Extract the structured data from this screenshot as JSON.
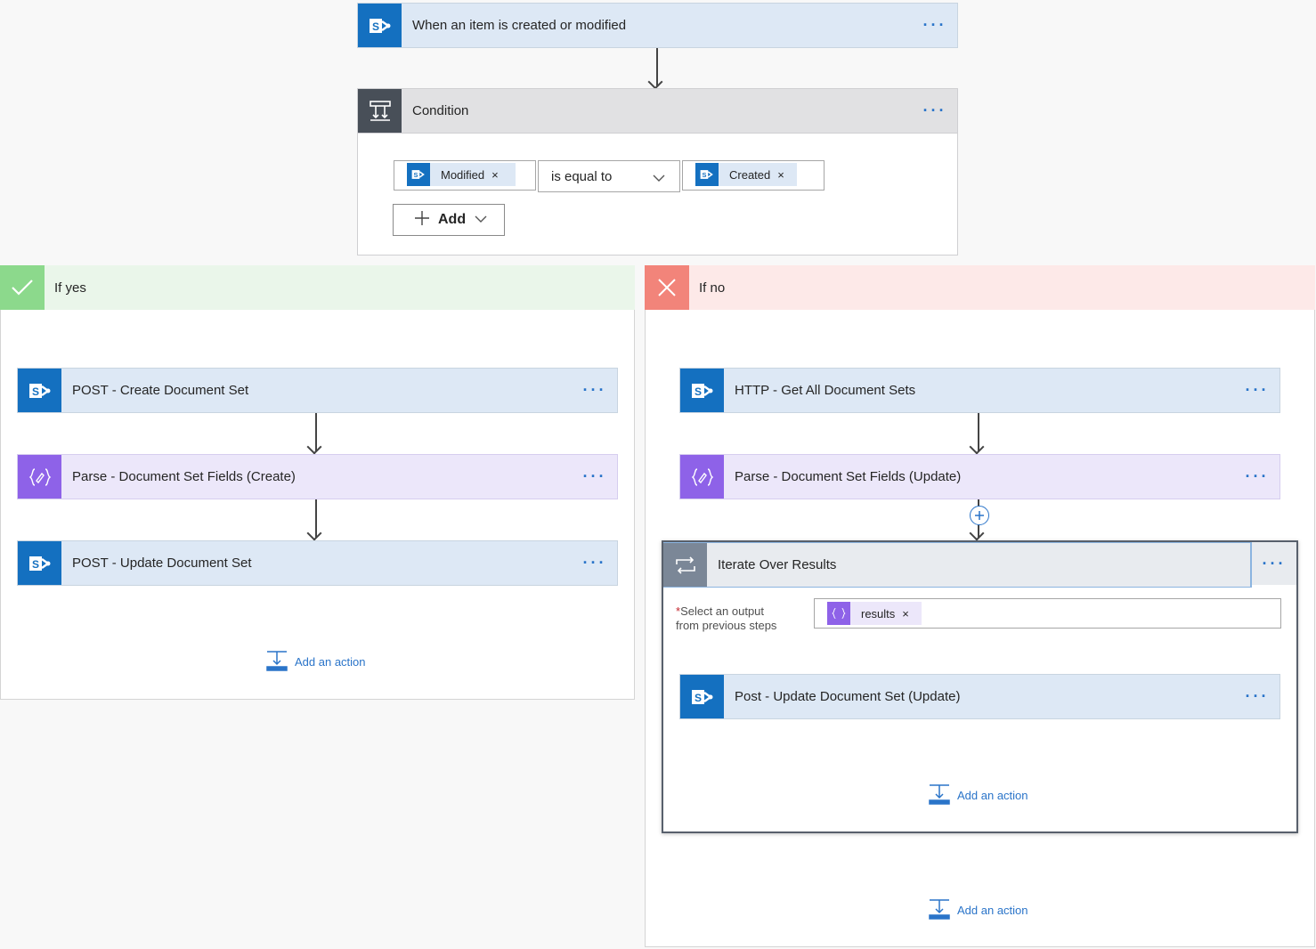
{
  "trigger": {
    "title": "When an item is created or modified",
    "more": "···"
  },
  "condition": {
    "title": "Condition",
    "more": "···",
    "left_token": "Modified",
    "operator": "is equal to",
    "right_token": "Created",
    "add_label": "Add",
    "remove_glyph": "×"
  },
  "yes_branch": {
    "header": "If yes",
    "actions": [
      {
        "title": "POST - Create Document Set",
        "icon": "sharepoint-icon"
      },
      {
        "title": "Parse - Document Set Fields (Create)",
        "icon": "parse-json-icon"
      },
      {
        "title": "POST - Update Document Set",
        "icon": "sharepoint-icon"
      }
    ],
    "add_action": "Add an action"
  },
  "no_branch": {
    "header": "If no",
    "actions": [
      {
        "title": "HTTP - Get All Document Sets",
        "icon": "sharepoint-icon"
      },
      {
        "title": "Parse - Document Set Fields (Update)",
        "icon": "parse-json-icon"
      }
    ],
    "loop": {
      "title": "Iterate Over Results",
      "more": "···",
      "field_required": "*",
      "field_label_1": "Select an output",
      "field_label_2": "from previous steps",
      "token": "results",
      "inner_action": "Post - Update Document Set (Update)",
      "add_action": "Add an action"
    },
    "add_action": "Add an action"
  },
  "colors": {
    "sharepoint": "#1470c0",
    "parse": "#8e62e8",
    "yes": "#8cd98c",
    "no": "#f2847a",
    "link": "#2a74c9"
  }
}
